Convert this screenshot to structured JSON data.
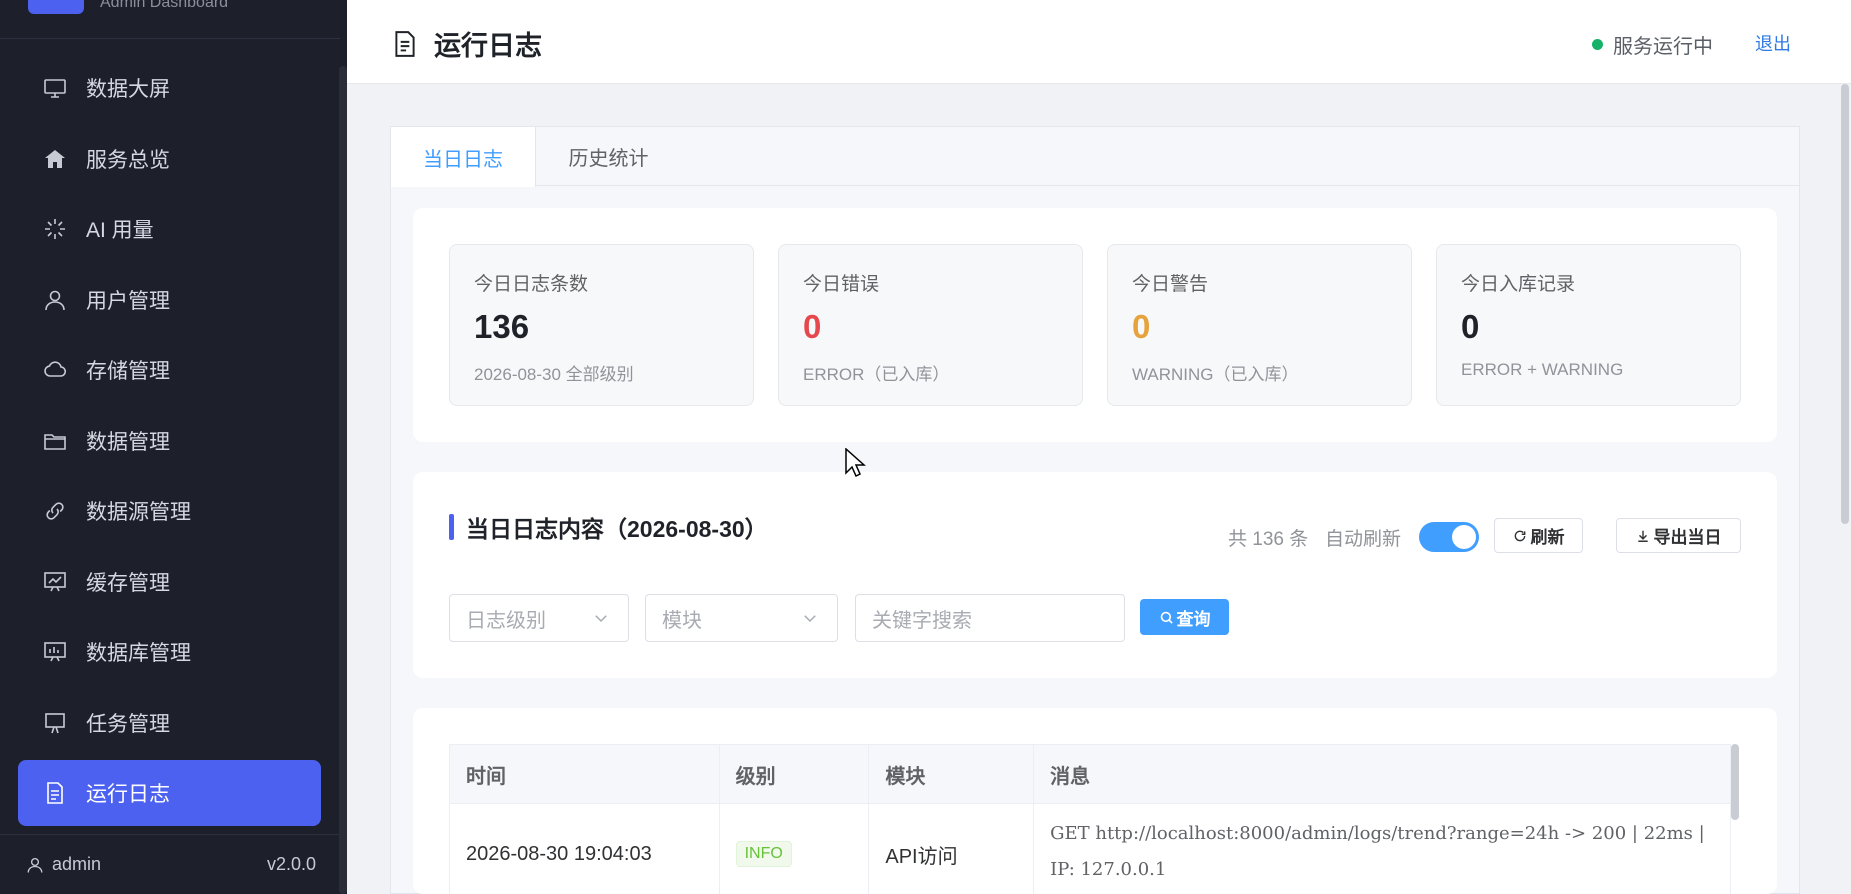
{
  "sidebar": {
    "brand_subtitle": "Admin Dashboard",
    "items": [
      {
        "label": "数据大屏",
        "icon": "monitor-icon"
      },
      {
        "label": "服务总览",
        "icon": "home-icon"
      },
      {
        "label": "AI 用量",
        "icon": "loading-icon"
      },
      {
        "label": "用户管理",
        "icon": "user-icon"
      },
      {
        "label": "存储管理",
        "icon": "cloud-icon"
      },
      {
        "label": "数据管理",
        "icon": "folder-icon"
      },
      {
        "label": "数据源管理",
        "icon": "link-icon"
      },
      {
        "label": "缓存管理",
        "icon": "chart-board-icon"
      },
      {
        "label": "数据库管理",
        "icon": "data-board-icon"
      },
      {
        "label": "任务管理",
        "icon": "easel-icon"
      },
      {
        "label": "运行日志",
        "icon": "document-icon",
        "active": true
      }
    ],
    "footer": {
      "user": "admin",
      "version": "v2.0.0"
    }
  },
  "header": {
    "title": "运行日志",
    "status": "服务运行中",
    "status_color": "#17b26a",
    "logout": "退出"
  },
  "tabs": [
    "当日日志",
    "历史统计"
  ],
  "stats": [
    {
      "label": "今日日志条数",
      "value": "136",
      "sub": "2026-08-30 全部级别",
      "color": "#1f2329"
    },
    {
      "label": "今日错误",
      "value": "0",
      "sub": "ERROR（已入库）",
      "color": "#e5484d"
    },
    {
      "label": "今日警告",
      "value": "0",
      "sub": "WARNING（已入库）",
      "color": "#e6a23c"
    },
    {
      "label": "今日入库记录",
      "value": "0",
      "sub": "ERROR + WARNING",
      "color": "#1f2329"
    }
  ],
  "content": {
    "title": "当日日志内容（2026-08-30）",
    "count": "共 136 条",
    "auto_refresh": "自动刷新",
    "auto_refresh_on": true,
    "refresh": "刷新",
    "export": "导出当日",
    "filters": {
      "level_placeholder": "日志级别",
      "module_placeholder": "模块",
      "keyword_placeholder": "关键字搜索",
      "query": "查询"
    }
  },
  "table": {
    "columns": [
      "时间",
      "级别",
      "模块",
      "消息"
    ],
    "rows": [
      {
        "time": "2026-08-30 19:04:03",
        "level": "INFO",
        "module": "API访问",
        "message": "GET http://localhost:8000/admin/logs/trend?range=24h -> 200 | 22ms | IP: 127.0.0.1"
      }
    ]
  }
}
